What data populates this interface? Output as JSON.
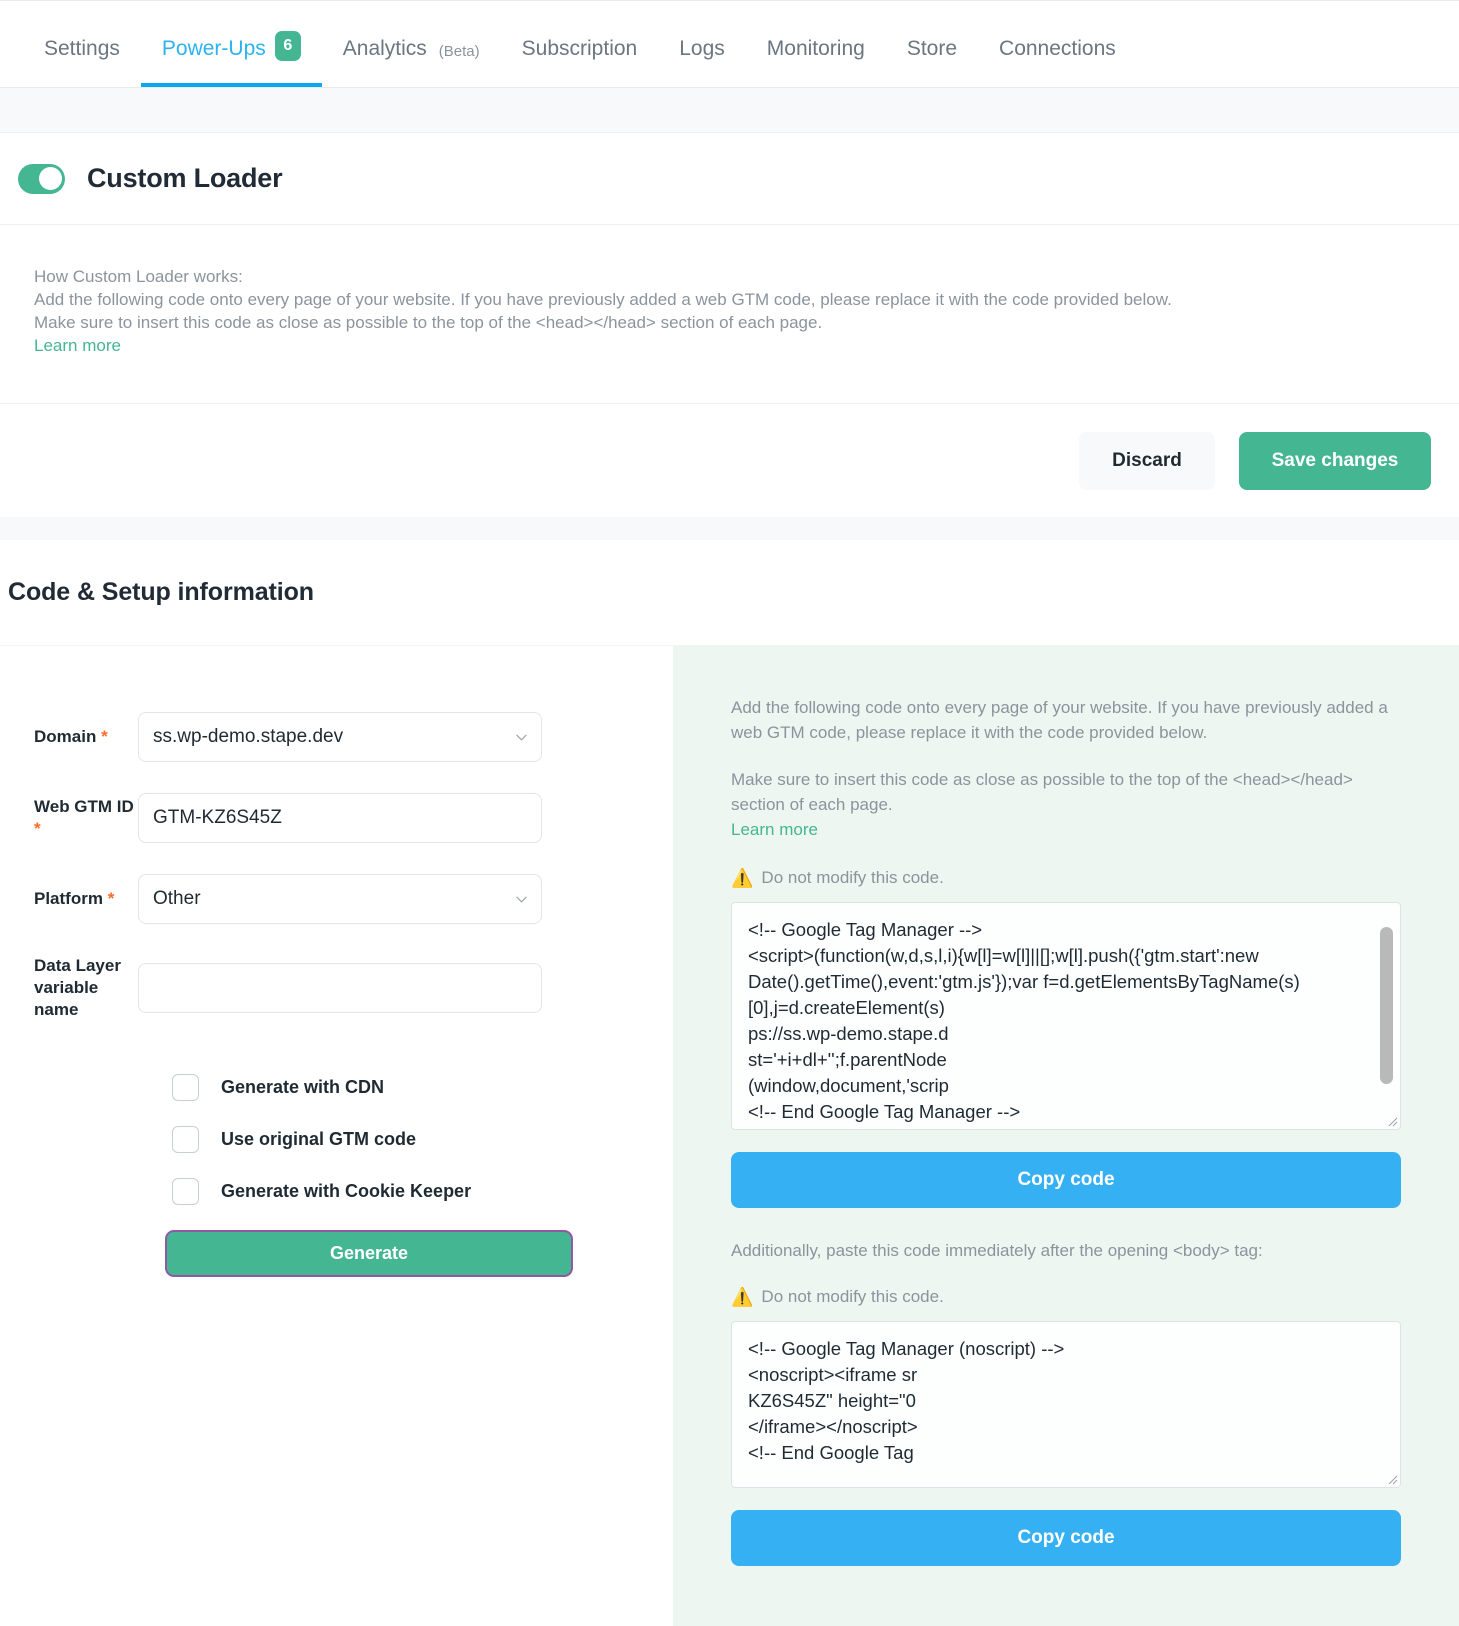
{
  "tabs": [
    {
      "label": "Settings",
      "active": false
    },
    {
      "label": "Power-Ups",
      "active": true,
      "badge": "6"
    },
    {
      "label": "Analytics",
      "suffix": "(Beta)",
      "active": false
    },
    {
      "label": "Subscription",
      "active": false
    },
    {
      "label": "Logs",
      "active": false
    },
    {
      "label": "Monitoring",
      "active": false
    },
    {
      "label": "Store",
      "active": false
    },
    {
      "label": "Connections",
      "active": false
    }
  ],
  "powerup": {
    "title": "Custom Loader",
    "toggle_on": true,
    "howto_heading": "How Custom Loader works:",
    "howto_line1": "Add the following code onto every page of your website. If you have previously added a web GTM code, please replace it with the code provided below.",
    "howto_line2": "Make sure to insert this code as close as possible to the top of the <head></head> section of each page.",
    "learn_more": "Learn more"
  },
  "actions": {
    "discard_label": "Discard",
    "save_label": "Save changes"
  },
  "setup": {
    "section_title": "Code & Setup information",
    "fields": [
      {
        "label": "Domain",
        "required": true,
        "value": "ss.wp-demo.stape.dev",
        "type": "select"
      },
      {
        "label": "Web GTM ID",
        "required": true,
        "value": "GTM-KZ6S45Z",
        "type": "text"
      },
      {
        "label": "Platform",
        "required": true,
        "value": "Other",
        "type": "select"
      },
      {
        "label": "Data Layer variable name",
        "required": false,
        "value": "",
        "placeholder": "",
        "type": "text"
      }
    ],
    "checkboxes": [
      {
        "label": "Generate with CDN",
        "checked": false
      },
      {
        "label": "Use original GTM code",
        "checked": false
      },
      {
        "label": "Generate with Cookie Keeper",
        "checked": false
      }
    ],
    "generate_label": "Generate"
  },
  "right_panel": {
    "intro1": "Add the following code onto every page of your website. If you have previously added a web GTM code, please replace it with the code provided below.",
    "intro2": "Make sure to insert this code as close as possible to the top of the <head></head> section of each page.",
    "learn_more": "Learn more",
    "warn1": "Do not modify this code.",
    "warn_icon": "⚠️",
    "head_code": "<!-- Google Tag Manager -->\n<script>(function(w,d,s,l,i){w[l]=w[l]||[];w[l].push({'gtm.start':new\nDate().getTime(),event:'gtm.js'});var f=d.getElementsByTagName(s)\n[0],j=d.createElement(s)\nps://ss.wp-demo.stape.d\nst='+i+dl+'';f.parentNode\n(window,document,'scrip\n<!-- End Google Tag Manager -->",
    "copy_label_1": "Copy code",
    "body_note": "Additionally, paste this code immediately after the opening <body> tag:",
    "warn2": "Do not modify this code.",
    "body_code": "<!-- Google Tag Manager (noscript) -->\n<noscript><iframe sr\nKZ6S45Z\" height=\"0\n</iframe></noscript>\n<!-- End Google Tag",
    "copy_label_2": "Copy code"
  },
  "colors": {
    "green": "#45b692",
    "blue": "#35b0f3",
    "tab_active": "#2bb3f0",
    "tab_underline": "#0aa9ef",
    "required": "#ff6a2b",
    "panel_bg": "#edf6f1",
    "purple_focus": "#9159a3"
  }
}
